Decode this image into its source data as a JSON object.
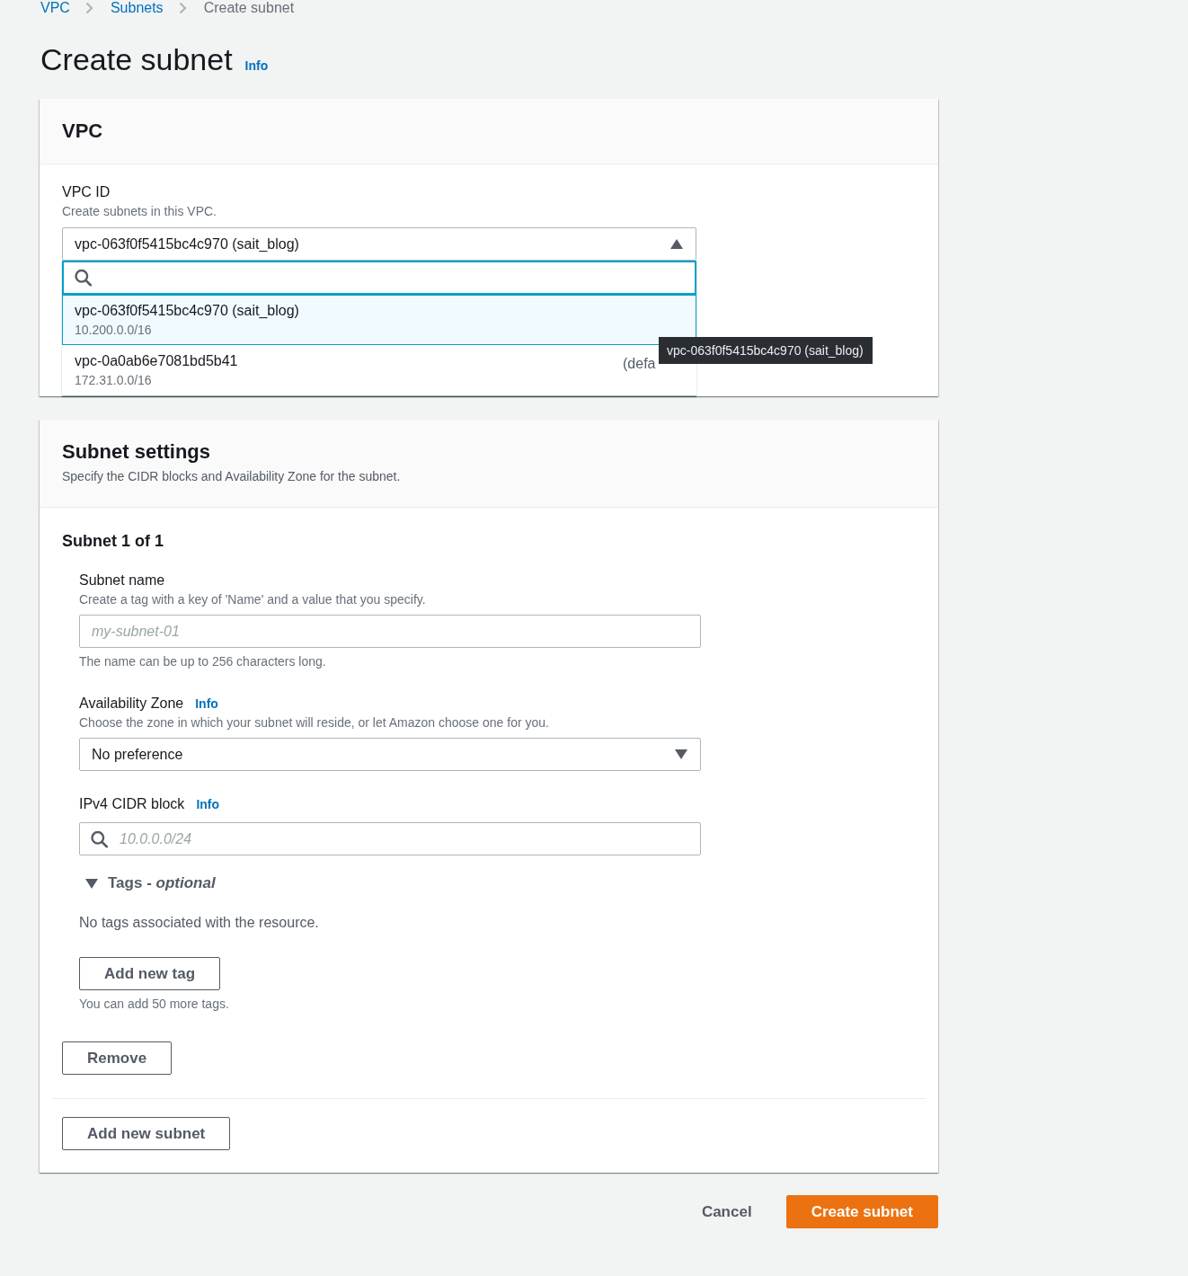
{
  "breadcrumbs": [
    {
      "label": "VPC",
      "current": false
    },
    {
      "label": "Subnets",
      "current": false
    },
    {
      "label": "Create subnet",
      "current": true
    }
  ],
  "page": {
    "title": "Create subnet",
    "info_link": "Info"
  },
  "vpc_panel": {
    "title": "VPC",
    "field": {
      "label": "VPC ID",
      "description": "Create subnets in this VPC.",
      "value": "vpc-063f0f5415bc4c970 (sait_blog)",
      "expanded": true
    },
    "dropdown": {
      "options": [
        {
          "label": "vpc-063f0f5415bc4c970 (sait_blog)",
          "cidr": "10.200.0.0/16",
          "selected": true
        },
        {
          "label": "vpc-0a0ab6e7081bd5b41",
          "tag": "(defa",
          "cidr": "172.31.0.0/16",
          "selected": false
        }
      ]
    },
    "tooltip": "vpc-063f0f5415bc4c970 (sait_blog)"
  },
  "subnet_panel": {
    "title": "Subnet settings",
    "description": "Specify the CIDR blocks and Availability Zone for the subnet.",
    "subnets": [
      {
        "heading": "Subnet 1 of 1",
        "fields": [
          {
            "kind": "text",
            "label": "Subnet name",
            "description": "Create a tag with a key of 'Name' and a value that you specify.",
            "placeholder": "my-subnet-01",
            "constraint": "The name can be up to 256 characters long."
          },
          {
            "kind": "select",
            "label": "Availability Zone",
            "info": "Info",
            "description": "Choose the zone in which your subnet will reside, or let Amazon choose one for you.",
            "value": "No preference"
          },
          {
            "kind": "search",
            "label": "IPv4 CIDR block",
            "info": "Info",
            "placeholder": "10.0.0.0/24"
          }
        ],
        "tags": {
          "title": "Tags - *optional*",
          "expanded": true,
          "empty_text": "No tags associated with the resource.",
          "add_button": "Add new tag",
          "limit_text": "You can add 50 more tags."
        },
        "remove_button": "Remove"
      }
    ],
    "add_button": "Add new subnet"
  },
  "actions": {
    "cancel": "Cancel",
    "submit": "Create subnet"
  }
}
